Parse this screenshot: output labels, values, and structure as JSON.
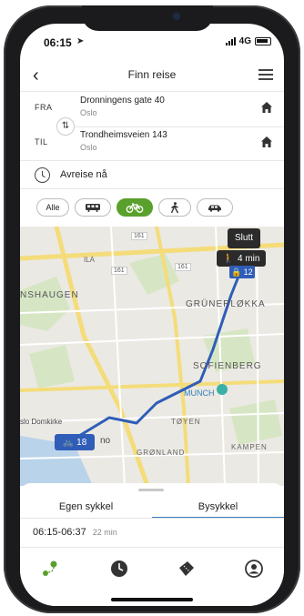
{
  "status": {
    "time": "06:15",
    "network": "4G"
  },
  "header": {
    "title": "Finn reise"
  },
  "route": {
    "from": {
      "label": "FRA",
      "address": "Dronningens gate 40",
      "city": "Oslo"
    },
    "to": {
      "label": "TIL",
      "address": "Trondheimsveien 143",
      "city": "Oslo"
    }
  },
  "departure": {
    "text": "Avreise nå"
  },
  "modes": [
    {
      "label": "Alle",
      "icon": "text",
      "active": false
    },
    {
      "label": "",
      "icon": "bus-icon",
      "active": false
    },
    {
      "label": "",
      "icon": "bicycle-icon",
      "active": true
    },
    {
      "label": "",
      "icon": "walk-icon",
      "active": false
    },
    {
      "label": "",
      "icon": "car-icon",
      "active": false
    }
  ],
  "map": {
    "areas": [
      "NSHAUGEN",
      "GRÜNERLØKKA",
      "SOFIENBERG",
      "TØYEN",
      "GRØNLAND",
      "KAMPEN",
      "ILA",
      "MUNCH"
    ],
    "places": [
      "slo Domkirke",
      "no"
    ],
    "road_numbers": [
      "161",
      "161",
      "161"
    ],
    "end_callout": "Slutt",
    "walk_minutes": "4 min",
    "end_bikes": "12",
    "start_bikes": "18"
  },
  "sheet": {
    "tabs": [
      "Egen sykkel",
      "Bysykkel"
    ],
    "active_tab": 1,
    "trip": {
      "times": "06:15-06:37",
      "duration": "22 min"
    }
  },
  "nav": [
    "route-icon",
    "clock-icon",
    "ticket-icon",
    "profile-icon"
  ],
  "colors": {
    "accent_green": "#5aa02c",
    "route_blue": "#2f5db8",
    "tab_blue": "#3b7fc4",
    "callout_dark": "#2b2b2b"
  }
}
